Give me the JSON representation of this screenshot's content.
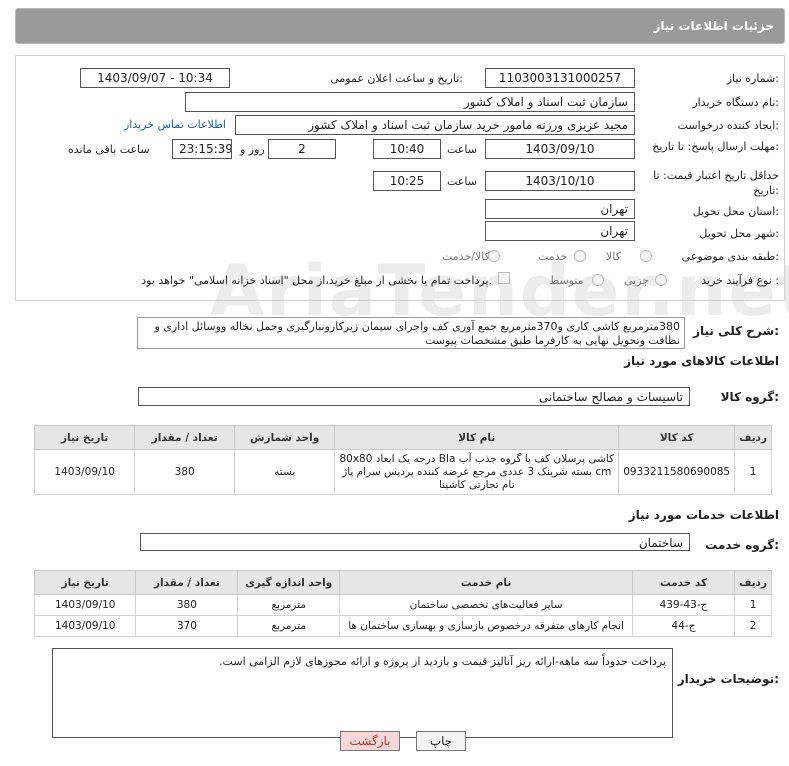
{
  "header": {
    "title": "جزئیات اطلاعات نیاز"
  },
  "form": {
    "need_number_label": "شماره نیاز:",
    "need_number": "1103003131000257",
    "announce_label": "تاریخ و ساعت اعلان عمومی:",
    "announce_value": "1403/09/07 - 10:34",
    "buyer_org_label": "نام دستگاه خریدار:",
    "buyer_org": "سازمان ثبت اسناد و املاک کشور",
    "creator_label": "ایجاد کننده درخواست:",
    "creator": "مجید عزیزی ورزنه مامور خرید سازمان ثبت اسناد و املاک کشور",
    "contact_link": "اطلاعات تماس خریدار",
    "reply_deadline_label": "مهلت ارسال پاسخ: تا تاریخ:",
    "reply_date": "1403/09/10",
    "time_label": "ساعت",
    "reply_time": "10:40",
    "days_count": "2",
    "days_label": "روز و",
    "remaining_time": "23:15:39",
    "remaining_label": "ساعت باقی مانده",
    "price_validity_label": "حداقل تاریخ اعتبار قیمت: تا تاریخ:",
    "validity_date": "1403/10/10",
    "validity_time": "10:25",
    "province_label": "استان محل تحویل:",
    "province": "تهران",
    "city_label": "شهر محل تحویل:",
    "city": "تهران",
    "category_label": "طبقه بندی موضوعی:",
    "category_options": [
      "کالا",
      "خدمت",
      "کالا/خدمت"
    ],
    "process_label": "نوع فرآیند خرید :",
    "process_options": [
      "جزیی",
      "متوسط"
    ],
    "treasury_note": "پرداخت تمام یا بخشی از مبلغ خرید،از محل \"اسناد خزانه اسلامی\" خواهد بود."
  },
  "description": {
    "label": "شرح کلی نیاز:",
    "text": "380مترمربع کاشی کاری و370مترمربع جمع آوری کف واجرای سیمان زیرکارونبارگیری وحمل نخاله ووسائل اداری و نظافت وتحویل نهایی به کارفرما طبق مشخصات پیوست"
  },
  "goods": {
    "section_title": "اطلاعات کالاهای مورد نیاز",
    "group_label": "گروه کالا:",
    "group_value": "تاسیسات و مصالح ساختمانی",
    "columns": [
      "ردیف",
      "کد کالا",
      "نام کالا",
      "واحد شمارش",
      "تعداد / مقدار",
      "تاریخ نیاز"
    ],
    "rows": [
      {
        "row": "1",
        "code": "0933211580690085",
        "name": "کاشی پرسلان کف با گروه جذب آب BIa درجه یک ابعاد 80x80 cm بسته شرینک 3 عددی مرجع عرضه کننده پردیس سرام پاژ نام تجارتی کاشینا",
        "unit": "بسته",
        "qty": "380",
        "date": "1403/09/10"
      }
    ]
  },
  "services": {
    "section_title": "اطلاعات خدمات مورد نیاز",
    "group_label": "گروه خدمت:",
    "group_value": "ساختمان",
    "columns": [
      "ردیف",
      "کد خدمت",
      "نام خدمت",
      "واحد اندازه گیری",
      "تعداد / مقدار",
      "تاریخ نیاز"
    ],
    "rows": [
      {
        "row": "1",
        "code": "ج-43-439",
        "name": "سایر فعالیت‌های تخصصی ساختمان",
        "unit": "مترمربع",
        "qty": "380",
        "date": "1403/09/10"
      },
      {
        "row": "2",
        "code": "ج-44",
        "name": "انجام کارهای متفرقه درخصوص بازسازی و بهسازی ساختمان ها",
        "unit": "مترمربع",
        "qty": "370",
        "date": "1403/09/10"
      }
    ]
  },
  "buyer_notes": {
    "label": "توضیحات خریدار:",
    "text": "پرداخت حدوداً سه ماهه-ارائه ریز آنالیز قیمت و بازدید از پروژه و ارائه مجوزهای لازم الزامی است."
  },
  "buttons": {
    "print": "چاپ",
    "back": "بازگشت"
  },
  "watermark": "AriaTender.net",
  "colors": {
    "header_bg": "#9a9a9a",
    "back_button_bg": "#f6d8d8",
    "print_button_bg": "#f4f4f4",
    "link": "#1a5fb4"
  }
}
